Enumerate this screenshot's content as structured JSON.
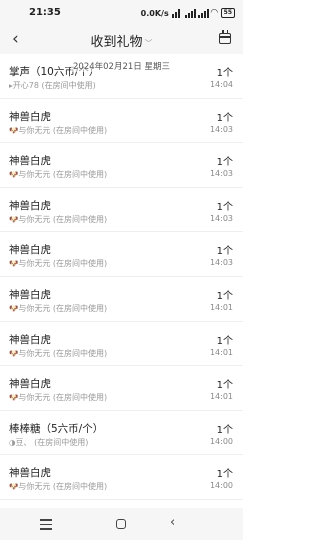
{
  "status": {
    "time": "21:35",
    "speed": "0.0K/s",
    "battery": "55"
  },
  "nav": {
    "title": "收到礼物"
  },
  "date_overlay": "2024年02月21日 星期三",
  "items": [
    {
      "name": "掌声（10六币/个）",
      "sub": "开心78 (在房间中使用)",
      "count": "1个",
      "time": "14:04"
    },
    {
      "name": "神兽白虎",
      "sub": "与你无元 (在房间中使用)",
      "count": "1个",
      "time": "14:03"
    },
    {
      "name": "神兽白虎",
      "sub": "与你无元 (在房间中使用)",
      "count": "1个",
      "time": "14:03"
    },
    {
      "name": "神兽白虎",
      "sub": "与你无元 (在房间中使用)",
      "count": "1个",
      "time": "14:03"
    },
    {
      "name": "神兽白虎",
      "sub": "与你无元 (在房间中使用)",
      "count": "1个",
      "time": "14:03"
    },
    {
      "name": "神兽白虎",
      "sub": "与你无元 (在房间中使用)",
      "count": "1个",
      "time": "14:01"
    },
    {
      "name": "神兽白虎",
      "sub": "与你无元 (在房间中使用)",
      "count": "1个",
      "time": "14:01"
    },
    {
      "name": "神兽白虎",
      "sub": "与你无元 (在房间中使用)",
      "count": "1个",
      "time": "14:01"
    },
    {
      "name": "棒棒糖（5六币/个）",
      "sub": "豆、 (在房间中使用)",
      "count": "1个",
      "time": "14:00"
    },
    {
      "name": "神兽白虎",
      "sub": "与你无元 (在房间中使用)",
      "count": "1个",
      "time": "14:00"
    }
  ]
}
